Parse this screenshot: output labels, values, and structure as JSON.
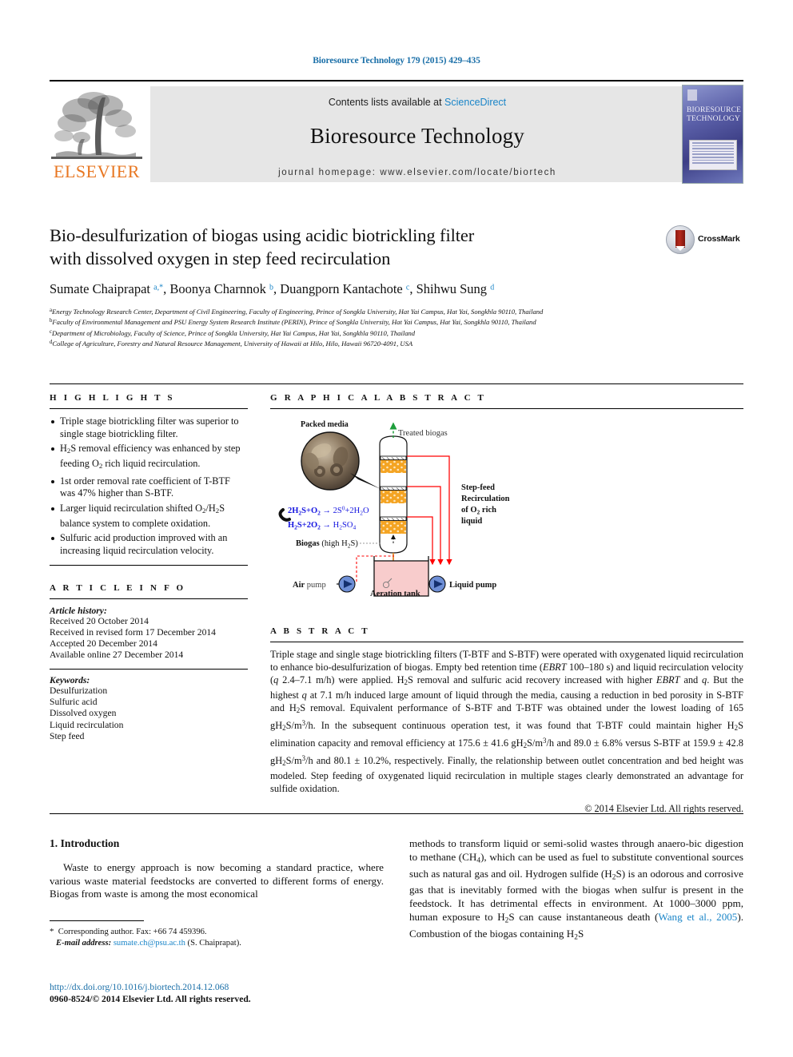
{
  "running_head": "Bioresource Technology 179 (2015) 429–435",
  "masthead": {
    "contents_prefix": "Contents lists available at ",
    "sciencedirect": "ScienceDirect",
    "journal_name": "Bioresource Technology",
    "homepage": "journal homepage: www.elsevier.com/locate/biortech",
    "publisher": "ELSEVIER",
    "cover_title_line1": "BIORESOURCE",
    "cover_title_line2": "TECHNOLOGY"
  },
  "article": {
    "title_line1": "Bio-desulfurization of biogas using acidic biotrickling filter",
    "title_line2": "with dissolved oxygen in step feed recirculation",
    "crossmark_label": "CrossMark",
    "authors_html": "Sumate Chaiprapat <sup>a,</sup><sup>*</sup>, Boonya Charnnok <sup>b</sup>, Duangporn Kantachote <sup>c</sup>, Shihwu Sung <sup>d</sup>",
    "affiliations": [
      {
        "marker": "a",
        "text": "Energy Technology Research Center, Department of Civil Engineering, Faculty of Engineering, Prince of Songkla University, Hat Yai Campus, Hat Yai, Songkhla 90110, Thailand"
      },
      {
        "marker": "b",
        "text": "Faculty of Environmental Management and PSU Energy System Research Institute (PERIN), Prince of Songkla University, Hat Yai Campus, Hat Yai, Songkhla 90110, Thailand"
      },
      {
        "marker": "c",
        "text": "Department of Microbiology, Faculty of Science, Prince of Songkla University, Hat Yai Campus, Hat Yai, Songkhla 90110, Thailand"
      },
      {
        "marker": "d",
        "text": "College of Agriculture, Forestry and Natural Resource Management, University of Hawaii at Hilo, Hilo, Hawaii 96720-4091, USA"
      }
    ]
  },
  "highlights": {
    "heading": "H I G H L I G H T S",
    "items_html": [
      "Triple stage biotrickling filter was superior to single stage biotrickling filter.",
      "H<sub>2</sub>S removal efficiency was enhanced by step feeding O<sub>2</sub> rich liquid recirculation.",
      "1st order removal rate coefficient of T-BTF was 47% higher than S-BTF.",
      "Larger liquid recirculation shifted O<sub>2</sub>/H<sub>2</sub>S balance system to complete oxidation.",
      "Sulfuric acid production improved with an increasing liquid recirculation velocity."
    ]
  },
  "article_info": {
    "heading": "A R T I C L E    I N F O",
    "history_label": "Article history:",
    "history": [
      "Received 20 October 2014",
      "Received in revised form 17 December 2014",
      "Accepted 20 December 2014",
      "Available online 27 December 2014"
    ],
    "keywords_label": "Keywords:",
    "keywords": [
      "Desulfurization",
      "Sulfuric acid",
      "Dissolved oxygen",
      "Liquid recirculation",
      "Step feed"
    ]
  },
  "graphical_abstract": {
    "heading": "G R A P H I C A L   A B S T R A C T",
    "labels": {
      "packed_media": "Packed media",
      "treated_biogas": "Treated biogas",
      "step_feed_l1": "Step-feed",
      "step_feed_l2": "Recirculation",
      "step_feed_l3_html": "of O<sub>2</sub> rich",
      "step_feed_l4": "liquid",
      "biogas_html": "Biogas (high H<sub>2</sub>S)",
      "air_pump": "Air pump",
      "liquid_pump": "Liquid pump",
      "aeration_tank": "Aeration tank",
      "equation1_html": "2H<sub>2</sub>S+O<sub>2</sub> &#8594; 2S<sup>0</sup>+2H<sub>2</sub>O",
      "equation2_html": "H<sub>2</sub>S+2O<sub>2</sub> &#8594; H<sub>2</sub>SO<sub>4</sub>"
    },
    "colors": {
      "media_orange": "#F4A423",
      "equation_blue": "#1414E0",
      "pipe_red": "#FF0000",
      "liquid_pink": "#F8CCCC",
      "pump_blue": "#6E8FD6",
      "arrow_orange": "#E08A2E",
      "treated_green": "#1E9E3C"
    }
  },
  "abstract": {
    "heading": "A B S T R A C T",
    "text_html": "Triple stage and single stage biotrickling filters (T-BTF and S-BTF) were operated with oxygenated liquid recirculation to enhance bio-desulfurization of biogas. Empty bed retention time (<i>EBRT</i> 100&#8211;180 s) and liquid recirculation velocity (<i>q</i> 2.4&#8211;7.1 m/h) were applied. H<sub>2</sub>S removal and sulfuric acid recovery increased with higher <i>EBRT</i> and <i>q</i>. But the highest <i>q</i> at 7.1 m/h induced large amount of liquid through the media, causing a reduction in bed porosity in S-BTF and H<sub>2</sub>S removal. Equivalent performance of S-BTF and T-BTF was obtained under the lowest loading of 165 gH<sub>2</sub>S/m<sup>3</sup>/h. In the subsequent continuous operation test, it was found that T-BTF could maintain higher H<sub>2</sub>S elimination capacity and removal efficiency at 175.6 &#177; 41.6 gH<sub>2</sub>S/m<sup>3</sup>/h and 89.0 &#177; 6.8% versus S-BTF at 159.9 &#177; 42.8 gH<sub>2</sub>S/m<sup>3</sup>/h and 80.1 &#177; 10.2%, respectively. Finally, the relationship between outlet concentration and bed height was modeled. Step feeding of oxygenated liquid recirculation in multiple stages clearly demonstrated an advantage for sulfide oxidation.",
    "copyright": "© 2014 Elsevier Ltd. All rights reserved."
  },
  "body": {
    "section_heading": "1. Introduction",
    "left_paragraph": "Waste to energy approach is now becoming a standard practice, where various waste material feedstocks are converted to different forms of energy. Biogas from waste is among the most economical",
    "right_paragraph_html": "methods to transform liquid or semi-solid wastes through anaero-bic digestion to methane (CH<sub>4</sub>), which can be used as fuel to substitute conventional sources such as natural gas and oil. Hydrogen sulfide (H<sub>2</sub>S) is an odorous and corrosive gas that is inevitably formed with the biogas when sulfur is present in the feedstock. It has detrimental effects in environment. At 1000&#8211;3000 ppm, human exposure to H<sub>2</sub>S can cause instantaneous death (<span class=\"cite\">Wang et al., 2005</span>). Combustion of the biogas containing H<sub>2</sub>S"
  },
  "footnote": {
    "corresponding_html": "<span class=\"star\">*</span> &nbsp;Corresponding author. Fax: +66 74 459396.",
    "email_label": "E-mail address:",
    "email": "sumate.ch@psu.ac.th",
    "email_suffix": "(S. Chaiprapat)."
  },
  "footer": {
    "doi": "http://dx.doi.org/10.1016/j.biortech.2014.12.068",
    "issn": "0960-8524/© 2014 Elsevier Ltd. All rights reserved."
  }
}
